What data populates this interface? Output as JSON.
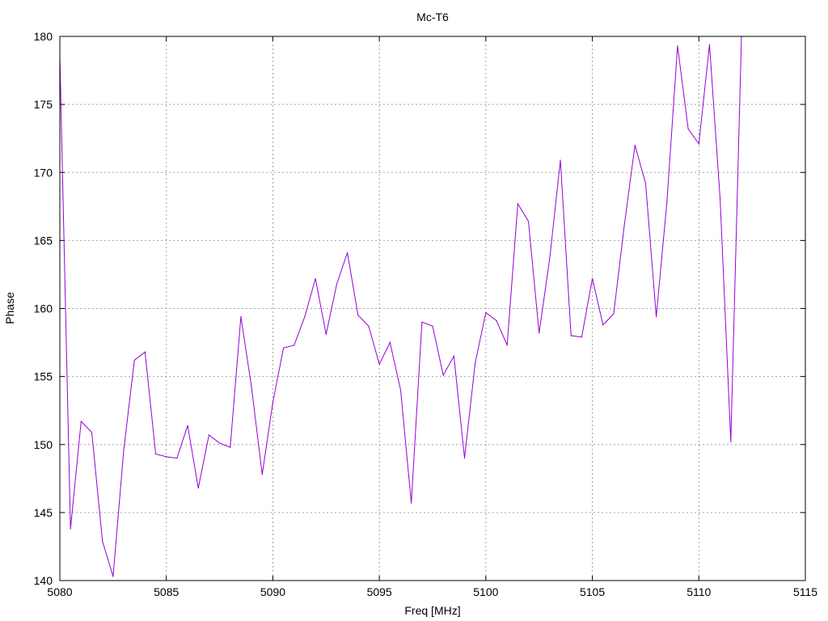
{
  "chart_data": {
    "type": "line",
    "title": "Mc-T6",
    "xlabel": "Freq [MHz]",
    "ylabel": "Phase",
    "xlim": [
      5080,
      5115
    ],
    "ylim": [
      140,
      180
    ],
    "xticks": [
      5080,
      5085,
      5090,
      5095,
      5100,
      5105,
      5110,
      5115
    ],
    "yticks": [
      140,
      145,
      150,
      155,
      160,
      165,
      170,
      175,
      180
    ],
    "grid": true,
    "line_color": "#9400d3",
    "series": [
      {
        "x": [
          5080,
          5080.5,
          5081,
          5081.5,
          5082,
          5082.5,
          5083,
          5083.5,
          5084,
          5084.5,
          5085,
          5085.5,
          5086,
          5086.5,
          5087,
          5087.5,
          5088,
          5088.5,
          5089,
          5089.5,
          5090,
          5090.5,
          5091,
          5091.5,
          5092,
          5092.5,
          5093,
          5093.5,
          5094,
          5094.5,
          5095,
          5095.5,
          5096,
          5096.5,
          5097,
          5097.5,
          5098,
          5098.5,
          5099,
          5099.5,
          5100,
          5100.5,
          5101,
          5101.5,
          5102,
          5102.5,
          5103,
          5103.5,
          5104,
          5104.5,
          5105,
          5105.5,
          5106,
          5106.5,
          5107,
          5107.5,
          5108,
          5108.5,
          5109,
          5109.5,
          5110,
          5110.5,
          5111,
          5111.5,
          5112
        ],
        "y": [
          178.6,
          143.8,
          151.7,
          150.9,
          142.9,
          140.3,
          149.6,
          156.2,
          156.8,
          149.3,
          149.1,
          149.0,
          151.4,
          146.8,
          150.7,
          150.1,
          149.8,
          159.4,
          154.2,
          147.8,
          153.1,
          157.1,
          157.3,
          159.4,
          162.2,
          158.1,
          161.8,
          164.1,
          159.5,
          158.7,
          155.9,
          157.5,
          154.0,
          145.7,
          159.0,
          158.7,
          155.1,
          156.5,
          149.0,
          156.0,
          159.7,
          159.1,
          157.3,
          167.7,
          166.4,
          158.2,
          163.7,
          170.9,
          158.0,
          157.9,
          162.2,
          158.8,
          159.6,
          166.1,
          172.0,
          169.2,
          159.4,
          167.8,
          179.3,
          173.2,
          172.1,
          179.4,
          168.0,
          150.2,
          180.0
        ]
      }
    ]
  }
}
